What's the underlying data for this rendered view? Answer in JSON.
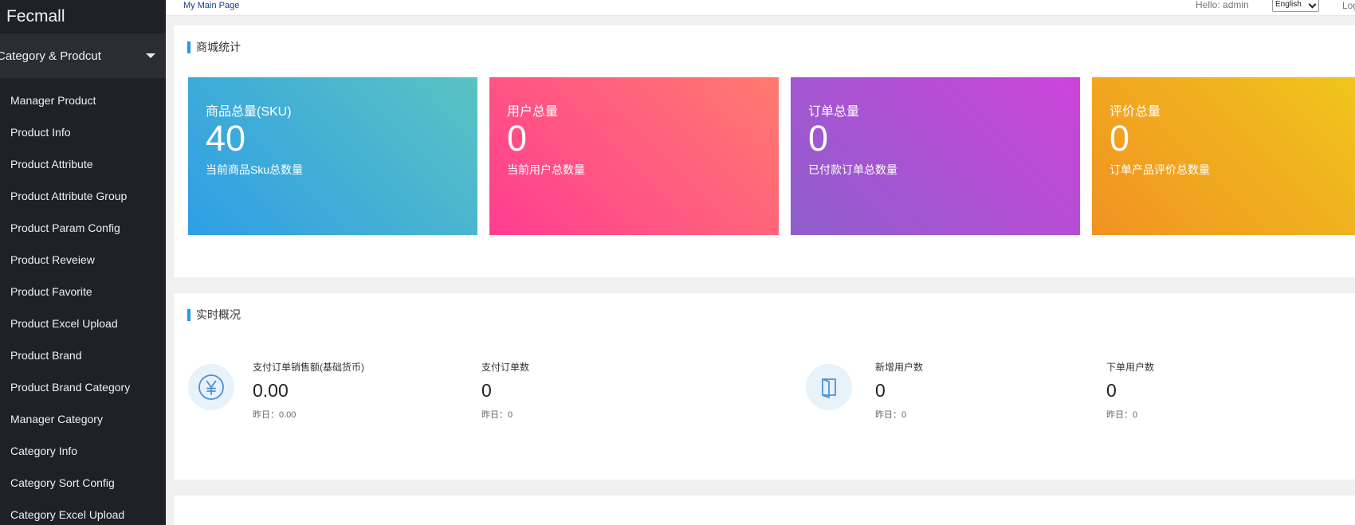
{
  "sidebar": {
    "brand": "Fecmall",
    "group_label": "Category & Prodcut",
    "items": [
      {
        "label": "Manager Product"
      },
      {
        "label": "Product Info"
      },
      {
        "label": "Product Attribute"
      },
      {
        "label": "Product Attribute Group"
      },
      {
        "label": "Product Param Config"
      },
      {
        "label": "Product Reveiew"
      },
      {
        "label": "Product Favorite"
      },
      {
        "label": "Product Excel Upload"
      },
      {
        "label": "Product Brand"
      },
      {
        "label": "Product Brand Category"
      },
      {
        "label": "Manager Category"
      },
      {
        "label": "Category Info"
      },
      {
        "label": "Category Sort Config"
      },
      {
        "label": "Category Excel Upload"
      }
    ]
  },
  "topbar": {
    "main_page_link": "My Main Page",
    "hello": "Hello: admin",
    "language_selected": "English",
    "logout_partial": "Log"
  },
  "stats_section": {
    "title": "商城统计",
    "cards": [
      {
        "title": "商品总量(SKU)",
        "value": "40",
        "desc": "当前商品Sku总数量"
      },
      {
        "title": "用户总量",
        "value": "0",
        "desc": "当前用户总数量"
      },
      {
        "title": "订单总量",
        "value": "0",
        "desc": "已付款订单总数量"
      },
      {
        "title": "评价总量",
        "value": "0",
        "desc": "订单产品评价总数量"
      }
    ]
  },
  "realtime_section": {
    "title": "实时概况",
    "items": [
      {
        "label": "支付订单销售额(基础货币)",
        "value": "0.00",
        "yesterday_label": "昨日：",
        "yesterday_value": "0.00"
      },
      {
        "label": "支付订单数",
        "value": "0",
        "yesterday_label": "昨日：",
        "yesterday_value": "0"
      },
      {
        "label": "新增用户数",
        "value": "0",
        "yesterday_label": "昨日：",
        "yesterday_value": "0"
      },
      {
        "label": "下单用户数",
        "value": "0",
        "yesterday_label": "昨日：",
        "yesterday_value": "0"
      }
    ],
    "icons": [
      "yen-icon",
      "door-icon"
    ]
  },
  "colors": {
    "sidebar_bg": "#1f2127",
    "accent": "#1e9be8",
    "card_blue": "#2e9ee6",
    "card_pink": "#ff3d91",
    "card_purple": "#8e5fcc",
    "card_orange": "#f19222"
  }
}
